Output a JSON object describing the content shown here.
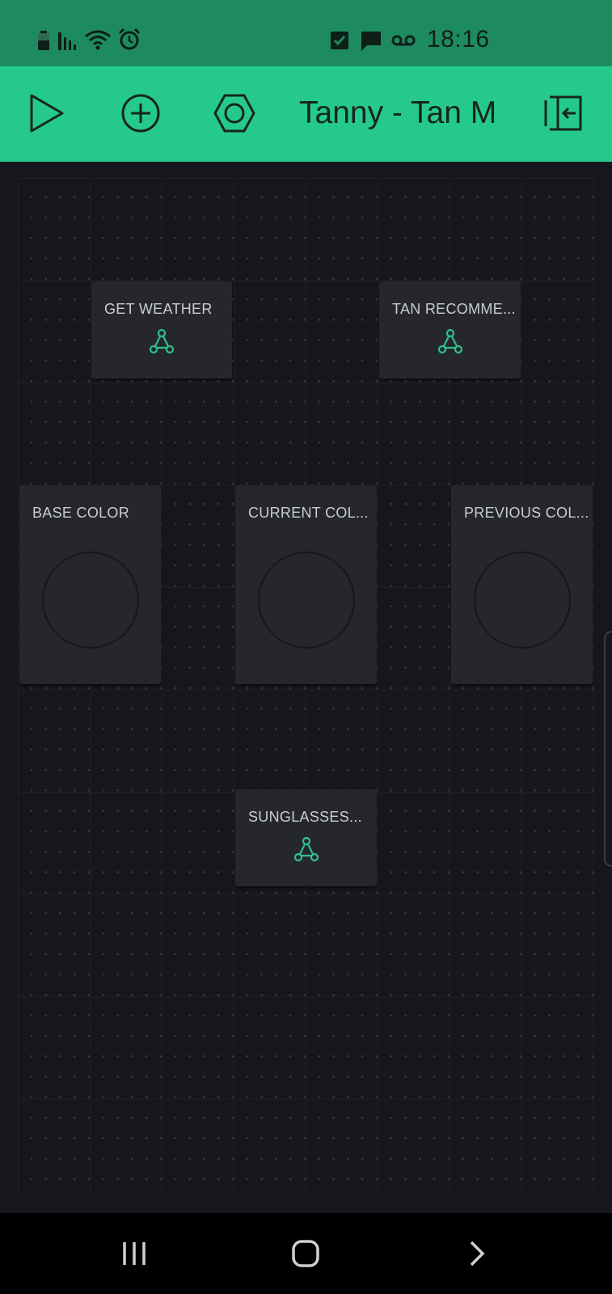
{
  "status_bar": {
    "time": "18:16",
    "left_icons": [
      "battery-icon",
      "signal-bars-icon",
      "wifi-icon",
      "alarm-icon"
    ],
    "right_icons": [
      "checkbox-notification-icon",
      "message-icon",
      "voicemail-icon"
    ],
    "background": "#1e8a62"
  },
  "toolbar": {
    "title": "Tanny - Tan M",
    "background": "#25c98e",
    "buttons": [
      "play-icon",
      "add-icon",
      "settings-icon",
      "exit-icon"
    ]
  },
  "widgets": {
    "get_weather": {
      "label": "GET WEATHER",
      "icon": "webhook-icon"
    },
    "tan_recommend": {
      "label": "TAN RECOMME...",
      "icon": "webhook-icon"
    },
    "base_color": {
      "label": "BASE COLOR"
    },
    "current_color": {
      "label": "CURRENT COL..."
    },
    "previous_color": {
      "label": "PREVIOUS COL..."
    },
    "sunglasses": {
      "label": "SUNGLASSES...",
      "icon": "webhook-icon"
    }
  },
  "colors": {
    "canvas_background": "#16171c",
    "widget_background": "#25272d",
    "accent_green": "#25c98e",
    "icon_green": "#2fbf8a"
  },
  "nav_bar": {
    "buttons": [
      "recent-apps-icon",
      "home-icon",
      "back-icon"
    ]
  }
}
